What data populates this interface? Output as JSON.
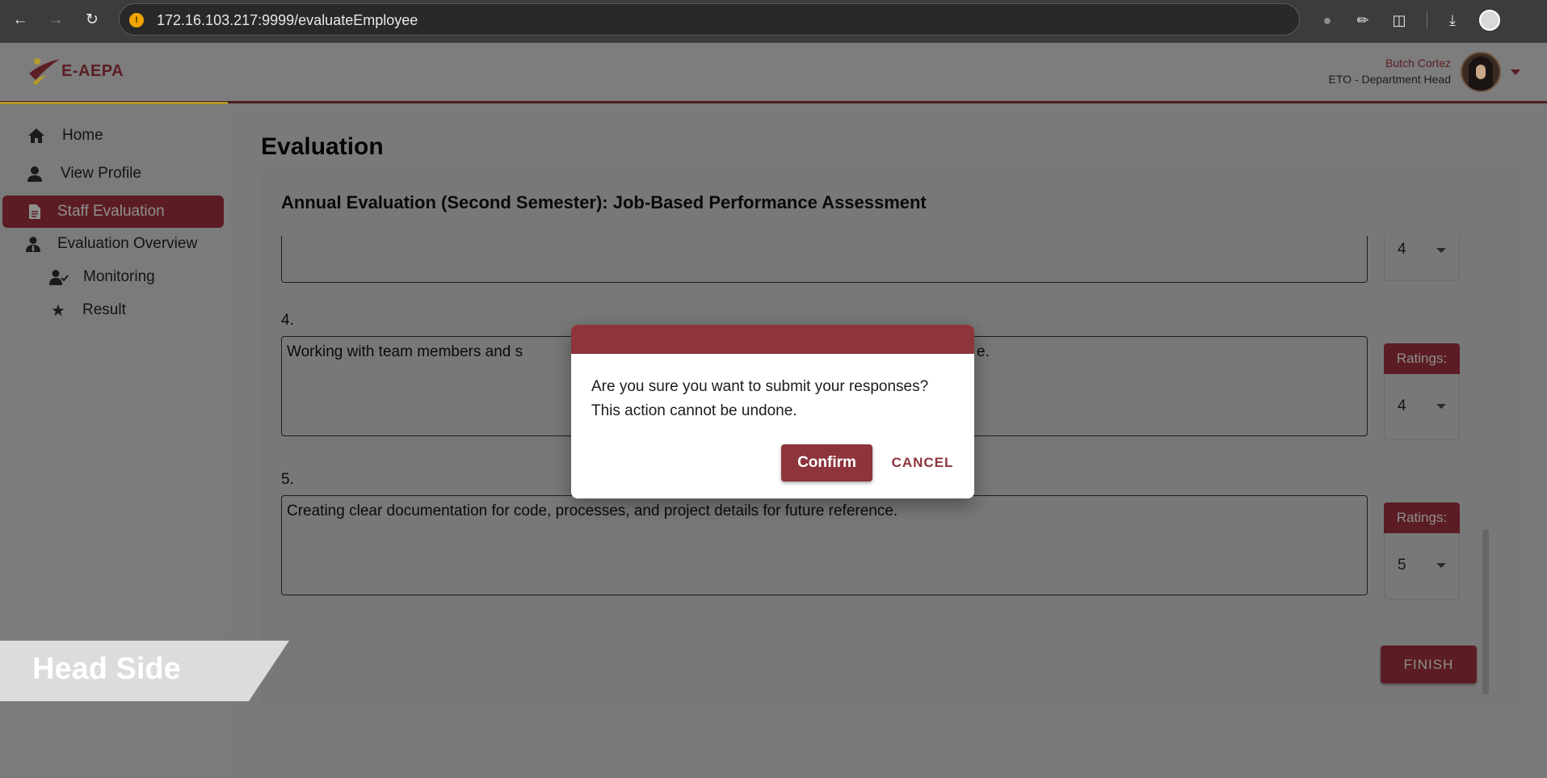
{
  "browser": {
    "url": "172.16.103.217:9999/evaluateEmployee"
  },
  "header": {
    "logo_text": "E-AEPA",
    "user_name": "Butch Cortez",
    "user_role": "ETO - Department Head"
  },
  "sidebar": {
    "items": [
      {
        "label": "Home",
        "icon": "home-icon"
      },
      {
        "label": "View Profile",
        "icon": "user-icon"
      },
      {
        "label": "Staff Evaluation",
        "icon": "document-icon",
        "active": true
      },
      {
        "label": "Evaluation Overview",
        "icon": "user-tie-icon"
      },
      {
        "label": "Monitoring",
        "icon": "user-check-icon"
      },
      {
        "label": "Result",
        "icon": "star-icon"
      }
    ]
  },
  "main": {
    "page_title": "Evaluation",
    "card_title": "Annual Evaluation (Second Semester): Job-Based Performance Assessment",
    "questions": [
      {
        "number": "",
        "text": "",
        "rating": "4"
      },
      {
        "number": "4.",
        "text_left": "Working with team members and s",
        "text_right": "e.",
        "rating_label": "Ratings:",
        "rating": "4"
      },
      {
        "number": "5.",
        "text": "Creating clear documentation for code, processes, and project details for future reference.",
        "rating_label": "Ratings:",
        "rating": "5"
      }
    ],
    "finish_label": "FINISH"
  },
  "dialog": {
    "message_line1": "Are you sure you want to submit your responses?",
    "message_line2": "This action cannot be undone.",
    "confirm_label": "Confirm",
    "cancel_label": "CANCEL"
  },
  "overlay_label": "Head Side",
  "colors": {
    "brand_maroon": "#5b1d23",
    "dialog_maroon": "#8d343c",
    "accent_gold": "#b49a28"
  }
}
